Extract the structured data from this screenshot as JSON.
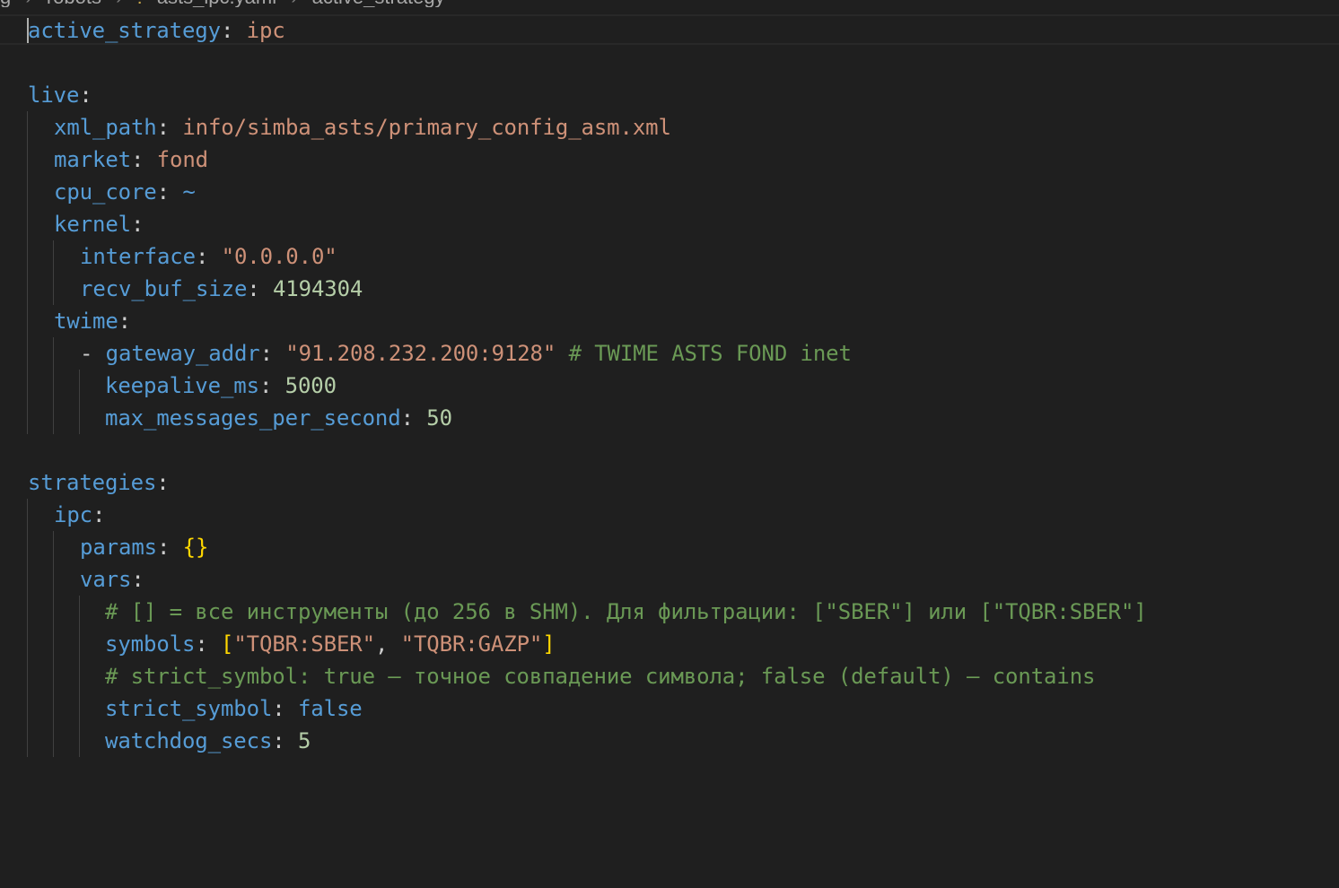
{
  "breadcrumb": {
    "items": [
      "g",
      "robots",
      "asts_ipc.yaml",
      "active_strategy"
    ],
    "separator": "›"
  },
  "colors": {
    "key": "#569cd6",
    "string": "#ce9178",
    "number": "#b5cea8",
    "comment": "#6a9955",
    "bool": "#569cd6",
    "bracket": "#ffd700",
    "punct": "#cccccc",
    "background": "#1f1f1f"
  },
  "lines": [
    {
      "tokens": [
        {
          "t": "k",
          "v": "active_strategy"
        },
        {
          "t": "p",
          "v": ": "
        },
        {
          "t": "s",
          "v": "ipc"
        }
      ]
    },
    {
      "tokens": []
    },
    {
      "tokens": [
        {
          "t": "k",
          "v": "live"
        },
        {
          "t": "p",
          "v": ":"
        }
      ]
    },
    {
      "tokens": [
        {
          "t": "k",
          "v": "xml_path"
        },
        {
          "t": "p",
          "v": ": "
        },
        {
          "t": "s",
          "v": "info/simba_asts/primary_config_asm.xml"
        }
      ]
    },
    {
      "tokens": [
        {
          "t": "k",
          "v": "market"
        },
        {
          "t": "p",
          "v": ": "
        },
        {
          "t": "s",
          "v": "fond"
        }
      ]
    },
    {
      "tokens": [
        {
          "t": "k",
          "v": "cpu_core"
        },
        {
          "t": "p",
          "v": ": "
        },
        {
          "t": "b",
          "v": "~"
        }
      ]
    },
    {
      "tokens": [
        {
          "t": "k",
          "v": "kernel"
        },
        {
          "t": "p",
          "v": ":"
        }
      ]
    },
    {
      "tokens": [
        {
          "t": "k",
          "v": "interface"
        },
        {
          "t": "p",
          "v": ": "
        },
        {
          "t": "s",
          "v": "\"0.0.0.0\""
        }
      ]
    },
    {
      "tokens": [
        {
          "t": "k",
          "v": "recv_buf_size"
        },
        {
          "t": "p",
          "v": ": "
        },
        {
          "t": "n",
          "v": "4194304"
        }
      ]
    },
    {
      "tokens": [
        {
          "t": "k",
          "v": "twime"
        },
        {
          "t": "p",
          "v": ":"
        }
      ]
    },
    {
      "tokens": [
        {
          "t": "p",
          "v": "- "
        },
        {
          "t": "k",
          "v": "gateway_addr"
        },
        {
          "t": "p",
          "v": ": "
        },
        {
          "t": "s",
          "v": "\"91.208.232.200:9128\""
        },
        {
          "t": "p",
          "v": " "
        },
        {
          "t": "c",
          "v": "# TWIME ASTS FOND inet"
        }
      ]
    },
    {
      "tokens": [
        {
          "t": "k",
          "v": "keepalive_ms"
        },
        {
          "t": "p",
          "v": ": "
        },
        {
          "t": "n",
          "v": "5000"
        }
      ]
    },
    {
      "tokens": [
        {
          "t": "k",
          "v": "max_messages_per_second"
        },
        {
          "t": "p",
          "v": ": "
        },
        {
          "t": "n",
          "v": "50"
        }
      ]
    },
    {
      "tokens": []
    },
    {
      "tokens": [
        {
          "t": "k",
          "v": "strategies"
        },
        {
          "t": "p",
          "v": ":"
        }
      ]
    },
    {
      "tokens": [
        {
          "t": "k",
          "v": "ipc"
        },
        {
          "t": "p",
          "v": ":"
        }
      ]
    },
    {
      "tokens": [
        {
          "t": "k",
          "v": "params"
        },
        {
          "t": "p",
          "v": ": "
        },
        {
          "t": "br",
          "v": "{}"
        }
      ]
    },
    {
      "tokens": [
        {
          "t": "k",
          "v": "vars"
        },
        {
          "t": "p",
          "v": ":"
        }
      ]
    },
    {
      "tokens": [
        {
          "t": "c",
          "v": "# [] = все инструменты (до 256 в SHM). Для фильтрации: [\"SBER\"] или [\"TQBR:SBER\"]"
        }
      ]
    },
    {
      "tokens": [
        {
          "t": "k",
          "v": "symbols"
        },
        {
          "t": "p",
          "v": ": "
        },
        {
          "t": "br",
          "v": "["
        },
        {
          "t": "s",
          "v": "\"TQBR:SBER\""
        },
        {
          "t": "p",
          "v": ", "
        },
        {
          "t": "s",
          "v": "\"TQBR:GAZP\""
        },
        {
          "t": "br",
          "v": "]"
        }
      ]
    },
    {
      "tokens": [
        {
          "t": "c",
          "v": "# strict_symbol: true — точное совпадение символа; false (default) — contains"
        }
      ]
    },
    {
      "tokens": [
        {
          "t": "k",
          "v": "strict_symbol"
        },
        {
          "t": "p",
          "v": ": "
        },
        {
          "t": "b",
          "v": "false"
        }
      ]
    },
    {
      "tokens": [
        {
          "t": "k",
          "v": "watchdog_secs"
        },
        {
          "t": "p",
          "v": ": "
        },
        {
          "t": "n",
          "v": "5"
        }
      ]
    }
  ]
}
